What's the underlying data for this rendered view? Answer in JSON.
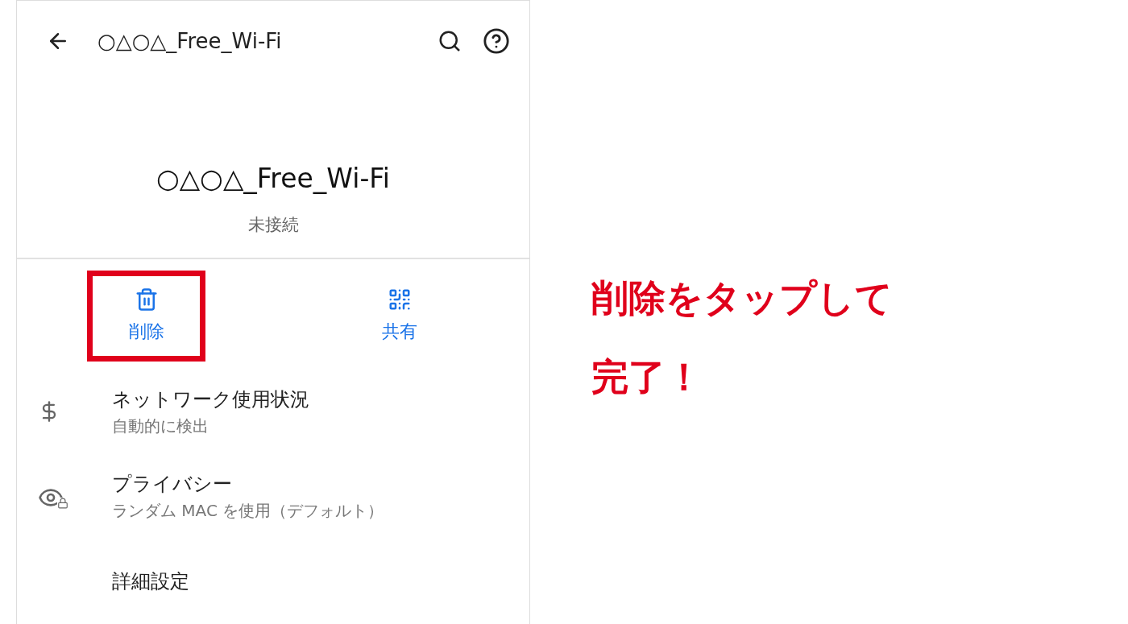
{
  "app_bar": {
    "title": "○△○△_Free_Wi-Fi"
  },
  "network": {
    "name": "○△○△_Free_Wi-Fi",
    "status": "未接続"
  },
  "actions": [
    {
      "kind": "delete",
      "label": "削除",
      "highlighted": true
    },
    {
      "kind": "share",
      "label": "共有",
      "highlighted": false
    }
  ],
  "settings": [
    {
      "kind": "usage",
      "title": "ネットワーク使用状況",
      "summary": "自動的に検出"
    },
    {
      "kind": "privacy",
      "title": "プライバシー",
      "summary": "ランダム MAC を使用（デフォルト）"
    },
    {
      "kind": "advanced",
      "title": "詳細設定"
    }
  ],
  "annotation": {
    "lines": [
      "削除をタップして",
      "完了！"
    ]
  }
}
